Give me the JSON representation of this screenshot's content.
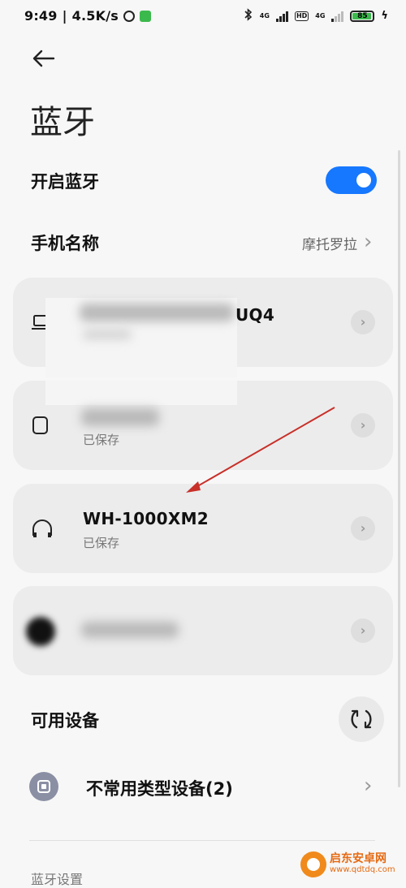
{
  "status_bar": {
    "time": "9:49",
    "speed": "4.5K/s",
    "net1": "4G",
    "net2": "4G",
    "hd": "HD",
    "battery": "85",
    "battery_level": 0.85
  },
  "header": {
    "title": "蓝牙"
  },
  "bluetooth_toggle": {
    "label": "开启蓝牙",
    "state": "on",
    "accent_color": "#1677ff"
  },
  "phone_name": {
    "label": "手机名称",
    "value": "摩托罗拉"
  },
  "paired_devices": [
    {
      "icon": "laptop-icon",
      "name_suffix": "UQ4",
      "subtitle": ""
    },
    {
      "icon": "phone-icon",
      "name_suffix": "",
      "subtitle": "已保存"
    },
    {
      "icon": "headphones-icon",
      "name": "WH-1000XM2",
      "subtitle": "已保存"
    },
    {
      "icon": "avatar-icon",
      "name_suffix": "",
      "subtitle": ""
    }
  ],
  "available_devices": {
    "label": "可用设备"
  },
  "rare_devices": {
    "label": "不常用类型设备(2)"
  },
  "bottom": {
    "settings_label": "蓝牙设置"
  },
  "watermark": {
    "line1": "启东安卓网",
    "line2": "www.qdtdq.com"
  }
}
